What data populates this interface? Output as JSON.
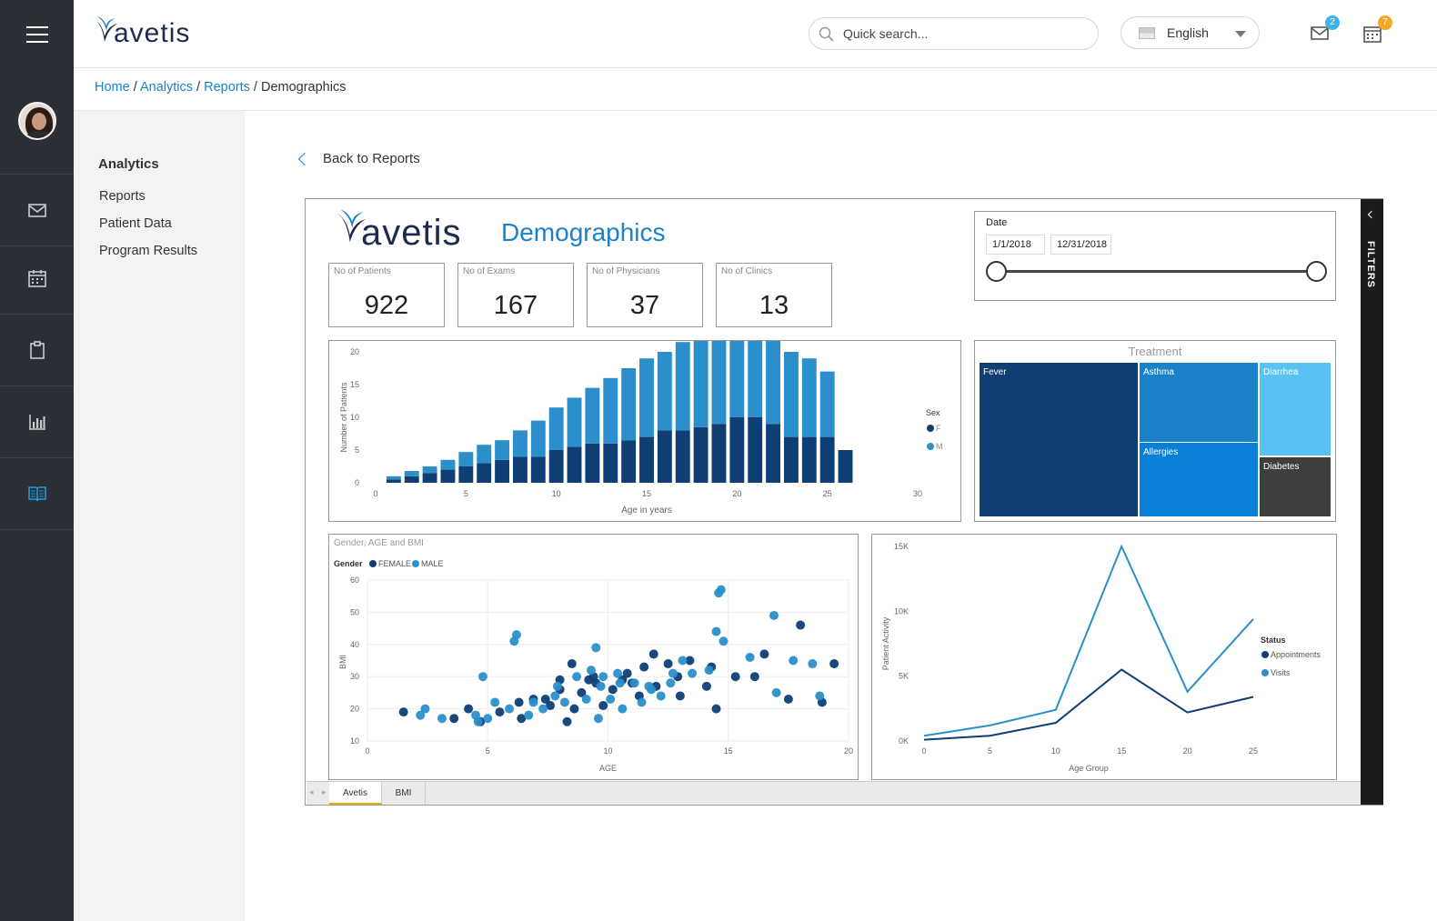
{
  "app": {
    "brand": "avetis",
    "search_placeholder": "Quick search...",
    "language": "English",
    "mail_count": "2",
    "calendar_count": "7",
    "colors": {
      "rail": "#2b3036",
      "accent": "#1a82c9",
      "mail_badge": "#3bb3e8",
      "calendar_badge": "#f5a623"
    }
  },
  "breadcrumb": {
    "items": [
      "Home",
      "Analytics",
      "Reports"
    ],
    "current": "Demographics",
    "sep": "/"
  },
  "subnav": {
    "title": "Analytics",
    "items": [
      "Reports",
      "Patient Data",
      "Program Results"
    ]
  },
  "back_label": "Back to Reports",
  "report": {
    "brand": "avetis",
    "title": "Demographics",
    "filters_label": "FILTERS",
    "kpis": [
      {
        "label": "No of Patients",
        "value": "922"
      },
      {
        "label": "No of Exams",
        "value": "167"
      },
      {
        "label": "No of Physicians",
        "value": "37"
      },
      {
        "label": "No of Clinics",
        "value": "13"
      }
    ],
    "date": {
      "label": "Date",
      "start": "1/1/2018",
      "end": "12/31/2018"
    },
    "tabs": [
      "Avetis",
      "BMI"
    ]
  },
  "chart_data": [
    {
      "type": "bar",
      "stacked": true,
      "xlabel": "Age in years",
      "ylabel": "Number of Patients",
      "xlim": [
        0,
        30
      ],
      "ylim": [
        0,
        20
      ],
      "xticks": [
        0,
        5,
        10,
        15,
        20,
        25,
        30
      ],
      "yticks": [
        0,
        5,
        10,
        15,
        20
      ],
      "legend_title": "Sex",
      "legend_position": "right",
      "categories": [
        1,
        2,
        3,
        4,
        5,
        6,
        7,
        8,
        9,
        10,
        11,
        12,
        13,
        14,
        15,
        16,
        17,
        18,
        19,
        20,
        21,
        22,
        23,
        24,
        25,
        26
      ],
      "series": [
        {
          "name": "F",
          "color": "#0f3e75",
          "values": [
            0.5,
            1,
            1.5,
            2,
            2.5,
            3,
            3.5,
            4,
            4,
            5,
            5.5,
            6,
            6,
            6.5,
            7,
            8,
            8,
            8.5,
            9,
            10,
            10,
            9,
            7,
            7,
            7,
            5
          ]
        },
        {
          "name": "M",
          "color": "#2a8fca",
          "values": [
            0.5,
            0.8,
            1,
            1.5,
            2.2,
            2.8,
            3,
            4,
            5.5,
            6.5,
            7.5,
            8.5,
            10,
            11,
            12,
            12,
            13.5,
            14.5,
            15.5,
            15.5,
            14,
            13,
            13,
            12,
            10,
            0
          ]
        }
      ]
    },
    {
      "type": "treemap",
      "title": "Treatment",
      "items": [
        {
          "label": "Fever",
          "color": "#0f3e75"
        },
        {
          "label": "Asthma",
          "color": "#1a82c9"
        },
        {
          "label": "Allergies",
          "color": "#0a7fd8"
        },
        {
          "label": "Diarrhea",
          "color": "#58c2f5"
        },
        {
          "label": "Diabetes",
          "color": "#3e3e3e"
        }
      ]
    },
    {
      "type": "scatter",
      "title": "Gender, AGE and BMI",
      "xlabel": "AGE",
      "ylabel": "BMI",
      "xlim": [
        0,
        20
      ],
      "ylim": [
        10,
        60
      ],
      "xticks": [
        0,
        5,
        10,
        15,
        20
      ],
      "yticks": [
        10,
        20,
        30,
        40,
        50,
        60
      ],
      "legend_title": "Gender",
      "legend_position": "top-left",
      "series": [
        {
          "name": "FEMALE",
          "color": "#0f3e75",
          "points": [
            [
              1.5,
              19
            ],
            [
              3.6,
              17
            ],
            [
              4.2,
              20
            ],
            [
              4.7,
              16
            ],
            [
              5.5,
              19
            ],
            [
              6.3,
              22
            ],
            [
              6.4,
              17
            ],
            [
              6.9,
              23
            ],
            [
              7.6,
              21
            ],
            [
              8,
              26
            ],
            [
              8.3,
              16
            ],
            [
              8.6,
              20
            ],
            [
              8.9,
              25
            ],
            [
              9.2,
              29
            ],
            [
              8.5,
              34
            ],
            [
              9.4,
              30
            ],
            [
              9.8,
              21
            ],
            [
              10.2,
              26
            ],
            [
              10.6,
              29
            ],
            [
              11.3,
              24
            ],
            [
              11.5,
              33
            ],
            [
              12,
              27
            ],
            [
              12.5,
              34
            ],
            [
              13,
              24
            ],
            [
              13.4,
              35
            ],
            [
              14.1,
              27
            ],
            [
              15.3,
              30
            ],
            [
              16.1,
              30
            ],
            [
              16.5,
              37
            ],
            [
              17.5,
              23
            ],
            [
              18,
              46
            ],
            [
              18.9,
              22
            ],
            [
              19.4,
              34
            ],
            [
              11,
              28
            ],
            [
              12.9,
              30
            ],
            [
              9.5,
              28
            ],
            [
              10.8,
              31
            ],
            [
              7.4,
              23
            ],
            [
              8,
              29
            ],
            [
              11.9,
              37
            ],
            [
              14.3,
              33
            ],
            [
              14.5,
              20
            ]
          ]
        },
        {
          "name": "MALE",
          "color": "#2a8fca",
          "points": [
            [
              2.2,
              18
            ],
            [
              2.4,
              20
            ],
            [
              3.1,
              17
            ],
            [
              4.5,
              18
            ],
            [
              4.6,
              16
            ],
            [
              5,
              17
            ],
            [
              4.8,
              30
            ],
            [
              5.3,
              22
            ],
            [
              6.1,
              41
            ],
            [
              6.2,
              43
            ],
            [
              5.9,
              20
            ],
            [
              6.7,
              18
            ],
            [
              7.3,
              20
            ],
            [
              7.8,
              24
            ],
            [
              8.2,
              22
            ],
            [
              8.7,
              30
            ],
            [
              9.1,
              23
            ],
            [
              9.3,
              32
            ],
            [
              9.5,
              39
            ],
            [
              9.6,
              17
            ],
            [
              9.8,
              30
            ],
            [
              10.1,
              23
            ],
            [
              10.4,
              31
            ],
            [
              10.6,
              20
            ],
            [
              11.1,
              28
            ],
            [
              11.4,
              22
            ],
            [
              11.7,
              27
            ],
            [
              12.2,
              24
            ],
            [
              12.6,
              28
            ],
            [
              13.1,
              35
            ],
            [
              13.5,
              31
            ],
            [
              14.2,
              32
            ],
            [
              14.6,
              56
            ],
            [
              14.7,
              57
            ],
            [
              14.5,
              44
            ],
            [
              14.8,
              41
            ],
            [
              15.9,
              36
            ],
            [
              16.9,
              49
            ],
            [
              17,
              25
            ],
            [
              17.7,
              35
            ],
            [
              18.5,
              34
            ],
            [
              18.8,
              24
            ],
            [
              10.5,
              28
            ],
            [
              9.7,
              27
            ],
            [
              11.8,
              26
            ],
            [
              12.7,
              31
            ],
            [
              7.9,
              27
            ],
            [
              6.9,
              22
            ]
          ]
        }
      ]
    },
    {
      "type": "line",
      "xlabel": "Age Group",
      "ylabel": "Patient Activity",
      "xlim": [
        0,
        25
      ],
      "ylim": [
        0,
        15000
      ],
      "xticks": [
        0,
        5,
        10,
        15,
        20,
        25
      ],
      "yticks": [
        "0K",
        "5K",
        "10K",
        "15K"
      ],
      "legend_title": "Status",
      "legend_position": "right",
      "x": [
        0,
        5,
        10,
        15,
        20,
        25
      ],
      "series": [
        {
          "name": "Appointments",
          "color": "#0f3e75",
          "values": [
            100,
            400,
            1400,
            5500,
            2200,
            3400
          ]
        },
        {
          "name": "Visits",
          "color": "#2a8fca",
          "values": [
            400,
            1200,
            2400,
            15000,
            3800,
            9400
          ]
        }
      ]
    }
  ]
}
